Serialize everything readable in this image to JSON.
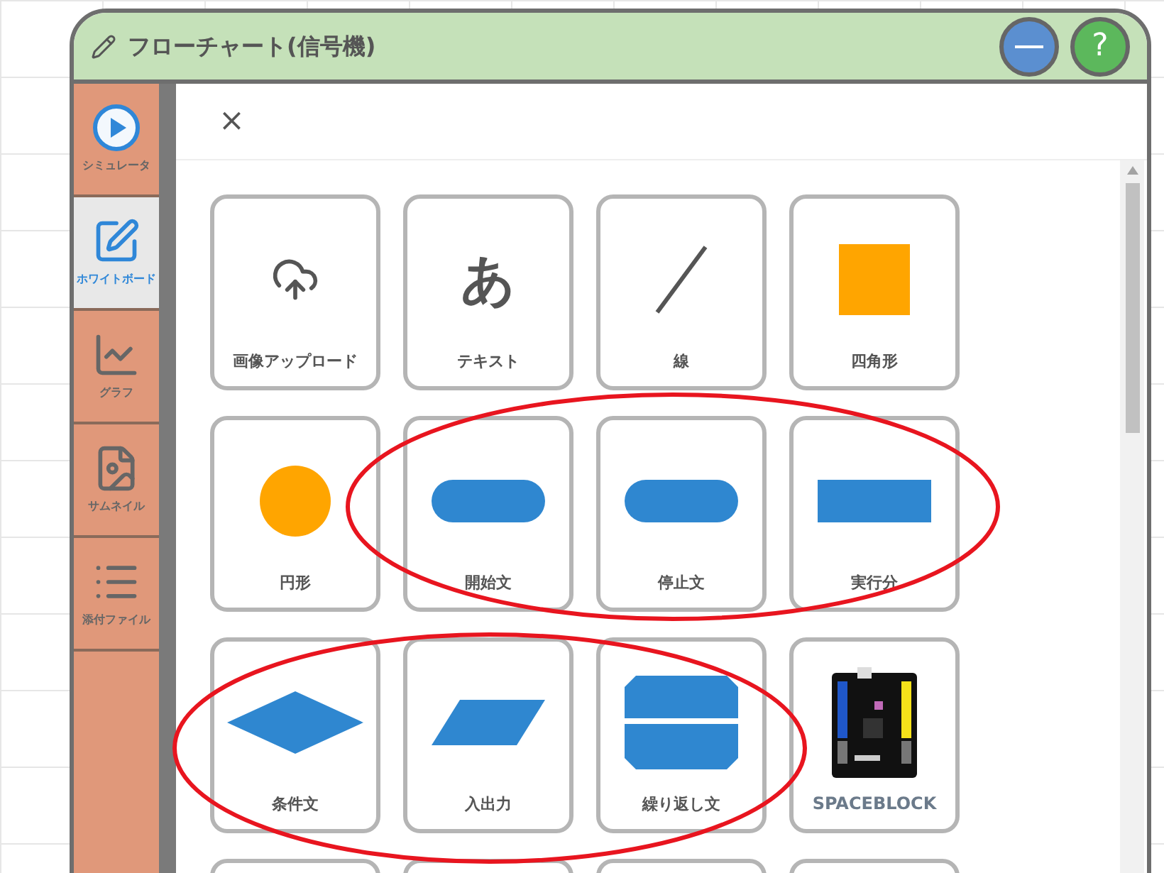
{
  "window": {
    "title": "フローチャート(信号機)"
  },
  "sidebar": {
    "items": [
      {
        "kind": "play",
        "label": "シミュレータ",
        "selected": false
      },
      {
        "kind": "edit",
        "label": "ホワイトボード",
        "selected": true
      },
      {
        "kind": "chart",
        "label": "グラフ",
        "selected": false
      },
      {
        "kind": "image",
        "label": "サムネイル",
        "selected": false
      },
      {
        "kind": "list",
        "label": "添付ファイル",
        "selected": false
      }
    ]
  },
  "title_buttons": {
    "help": "?"
  },
  "dialog": {
    "close": "×"
  },
  "tiles": [
    {
      "kind": "upload",
      "label": "画像アップロード"
    },
    {
      "kind": "glyph",
      "glyph": "あ",
      "label": "テキスト"
    },
    {
      "kind": "line",
      "label": "線"
    },
    {
      "kind": "square",
      "label": "四角形"
    },
    {
      "kind": "circle",
      "label": "円形"
    },
    {
      "kind": "pill",
      "label": "開始文"
    },
    {
      "kind": "pill",
      "label": "停止文"
    },
    {
      "kind": "rect",
      "label": "実行分"
    },
    {
      "kind": "diamond",
      "label": "条件文"
    },
    {
      "kind": "parallelogram",
      "label": "入出力"
    },
    {
      "kind": "loop",
      "label": "繰り返し文"
    },
    {
      "kind": "board",
      "label": "SPACEBLOCK"
    },
    {
      "kind": "blank"
    },
    {
      "kind": "blank"
    },
    {
      "kind": "blank"
    },
    {
      "kind": "blank"
    }
  ],
  "annotations": [
    {
      "kind": "ellipse",
      "color": "#e8151f"
    },
    {
      "kind": "ellipse",
      "color": "#e8151f"
    }
  ]
}
